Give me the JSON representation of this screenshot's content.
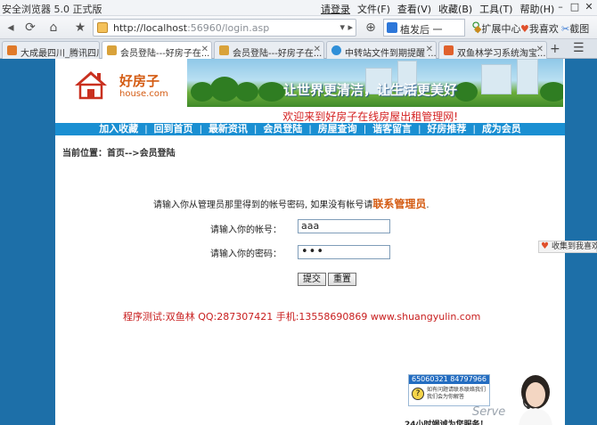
{
  "browser": {
    "title": "安全浏览器 5.0 正式版",
    "login_link": "请登录",
    "menus": [
      "文件(F)",
      "查看(V)",
      "收藏(B)",
      "工具(T)",
      "帮助(H)"
    ],
    "address_host": "http://localhost",
    "address_rest": ":56960/login.asp",
    "search_text": "植发后 一",
    "extensions": [
      "扩展中心",
      "我喜欢",
      "截图"
    ]
  },
  "tabs": [
    {
      "label": "大成最四川_腾讯四川...",
      "active": false,
      "color": "#e07a2a"
    },
    {
      "label": "会员登陆---好房子在...",
      "active": true,
      "color": "#d9a23a"
    },
    {
      "label": "会员登陆---好房子在...",
      "active": false,
      "color": "#d9a23a"
    },
    {
      "label": "中转站文件到期提醒 ...",
      "active": false,
      "color": "#2f8fd8"
    },
    {
      "label": "双鱼林学习系统淘宝...",
      "active": false,
      "color": "#e0612c"
    }
  ],
  "site": {
    "logo_cn": "好房子",
    "logo_en": "house.com",
    "slogan": "让世界更清洁，让生活更美好",
    "welcome": "欢迎来到好房子在线房屋出租管理网!",
    "nav": [
      "加入收藏",
      "回到首页",
      "最新资讯",
      "会员登陆",
      "房屋查询",
      "谐客留言",
      "好房推荐",
      "成为会员"
    ],
    "breadcrumb": "当前位置：首页-->会员登陆"
  },
  "login": {
    "notice": "请输入你从管理员那里得到的帐号密码, 如果没有帐号请",
    "notice_link": "联系管理员",
    "notice_end": ".",
    "account_label": "请输入你的帐号：",
    "account_value": "aaa",
    "password_label": "请输入你的密码：",
    "password_value": "•••",
    "submit": "提交",
    "reset": "重置"
  },
  "credit": "程序测试:双鱼林 QQ:287307421 手机:13558690869 www.shuangyulin.com",
  "float_fav": "收集到我喜欢",
  "service": {
    "phones": "65060321  84797966",
    "line1": "如有问题请联系联络我们",
    "line2": "我们会为你解答",
    "serve": "Serve",
    "bottom": "24小时竭诚为您服务！"
  }
}
